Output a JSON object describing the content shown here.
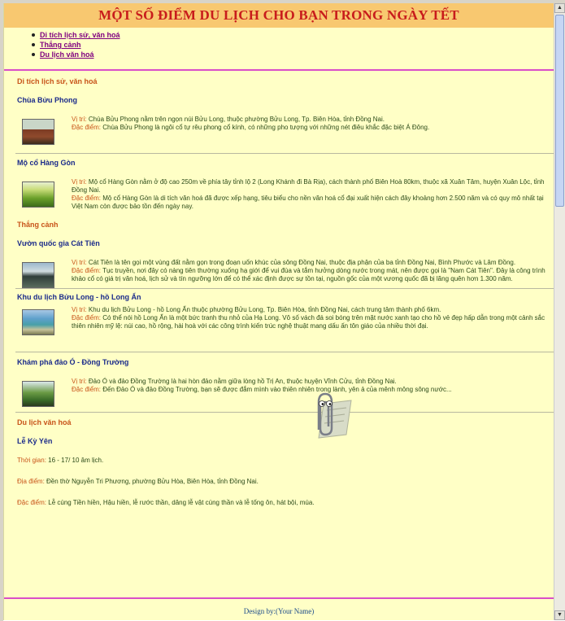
{
  "title": "MỘT SỐ ĐIỂM DU LỊCH CHO BẠN TRONG NGÀY TẾT",
  "toc": [
    "Di tích lịch sử, văn hoá",
    "Thắng cảnh",
    "Du lịch văn hoá"
  ],
  "sections": {
    "heritage": {
      "title": "Di tích lịch sử, văn hoá",
      "item1": {
        "title": "Chùa Bửu Phong",
        "loc_label": "Vị trí:",
        "loc_text": "Chùa Bửu Phong nằm trên ngọn núi Bửu Long, thuộc phường Bửu Long, Tp. Biên Hòa, tỉnh Đồng Nai.",
        "feat_label": "Đặc điểm:",
        "feat_text": "Chùa Bửu Phong là ngôi cổ tự rêu phong cổ kính, có những pho tượng với những nét điêu khắc đặc biệt Á Đông."
      },
      "item2": {
        "title": "Mộ cổ Hàng Gòn",
        "loc_label": "Vị trí:",
        "loc_text": "Mộ cổ Hàng Gòn nằm ở độ cao 250m về phía tây tỉnh lộ 2 (Long Khánh đi Bà Rịa), cách thành phố Biên Hoà 80km, thuộc xã Xuân Tâm, huyện Xuân Lộc, tỉnh Đồng Nai.",
        "feat_label": "Đặc điểm:",
        "feat_text": "Mộ cổ Hàng Gòn là di tích văn hoá đã được xếp hạng, tiêu biểu cho nền văn hoá cổ đại xuất hiện cách đây khoảng hơn 2.500 năm và có quy mô nhất tại Việt Nam còn được bảo tồn đến ngày nay."
      }
    },
    "scenery": {
      "title": "Thắng cảnh",
      "item1": {
        "title": "Vườn quốc gia Cát Tiên",
        "loc_label": "Vị trí:",
        "loc_text": "Cát Tiên là tên gọi một vùng đất nằm gọn trong đoạn uốn khúc của sông Đồng Nai, thuộc địa phận của ba tỉnh Đồng Nai, Bình Phước và Lâm Đồng.",
        "feat_label": "Đặc điểm:",
        "feat_text": "Tục truyền, nơi đây có nàng tiên thường xuống hạ giới để vui đùa và tắm hưởng dòng nước trong mát, nên được gọi là \"Nam Cát Tiên\". Đây là công trình khảo cổ có giá trị văn hoá, lịch sử và tín ngưỡng lớn để có thể xác định được sự tồn tại, nguồn gốc của một vương quốc đã bị lãng quên hơn 1.300 năm."
      },
      "item2": {
        "title": "Khu du lịch Bửu Long - hồ Long Ẩn",
        "loc_label": "Vị trí:",
        "loc_text": "Khu du lịch Bửu Long - hồ Long Ẩn thuộc phường Bửu Long, Tp. Biên Hòa, tỉnh Đồng Nai, cách trung tâm thành phố 6km.",
        "feat_label": "Đặc điểm:",
        "feat_text": "Có thể nói hồ Long Ẩn là một bức tranh thu nhỏ của Hạ Long. Vô số vách đá soi bóng trên mặt nước xanh tạo cho hồ vẻ đẹp hấp dẫn trong một cảnh sắc thiên nhiên mỹ lệ: núi cao, hồ rộng, hài hoà với các công trình kiến trúc nghệ thuật mang dấu ấn tôn giáo của nhiều thời đại."
      },
      "item3": {
        "title": "Khám phá đảo Ó - Đồng Trường",
        "loc_label": "Vị trí:",
        "loc_text": "Đảo Ó và đảo Đồng Trường là hai hòn đảo nằm giữa lòng hồ Trị An, thuộc huyện Vĩnh Cửu, tỉnh Đồng Nai.",
        "feat_label": "Đặc điểm:",
        "feat_text": "Đến Đảo Ó và đảo Đồng Trường, bạn sẽ được đắm mình vào thiên nhiên trong lành, yên ả của mênh mông sông nước..."
      }
    },
    "culture": {
      "title": "Du lịch văn hoá",
      "event_title": "Lễ Kỳ Yên",
      "time_label": "Thời gian:",
      "time_text": "16 - 17/ 10 âm lịch.",
      "place_label": "Địa điểm:",
      "place_text": "Đền thờ Nguyễn Tri Phương, phường Bửu Hòa, Biên Hòa, tỉnh Đồng Nai.",
      "feat_label": "Đặc điểm:",
      "feat_text": "Lễ cúng Tiền hiền, Hậu hiền, lễ rước thần, dâng lễ vật cúng thần và lễ tống ôn, hát bội, múa."
    }
  },
  "footer": "Design by:(Your Name)"
}
